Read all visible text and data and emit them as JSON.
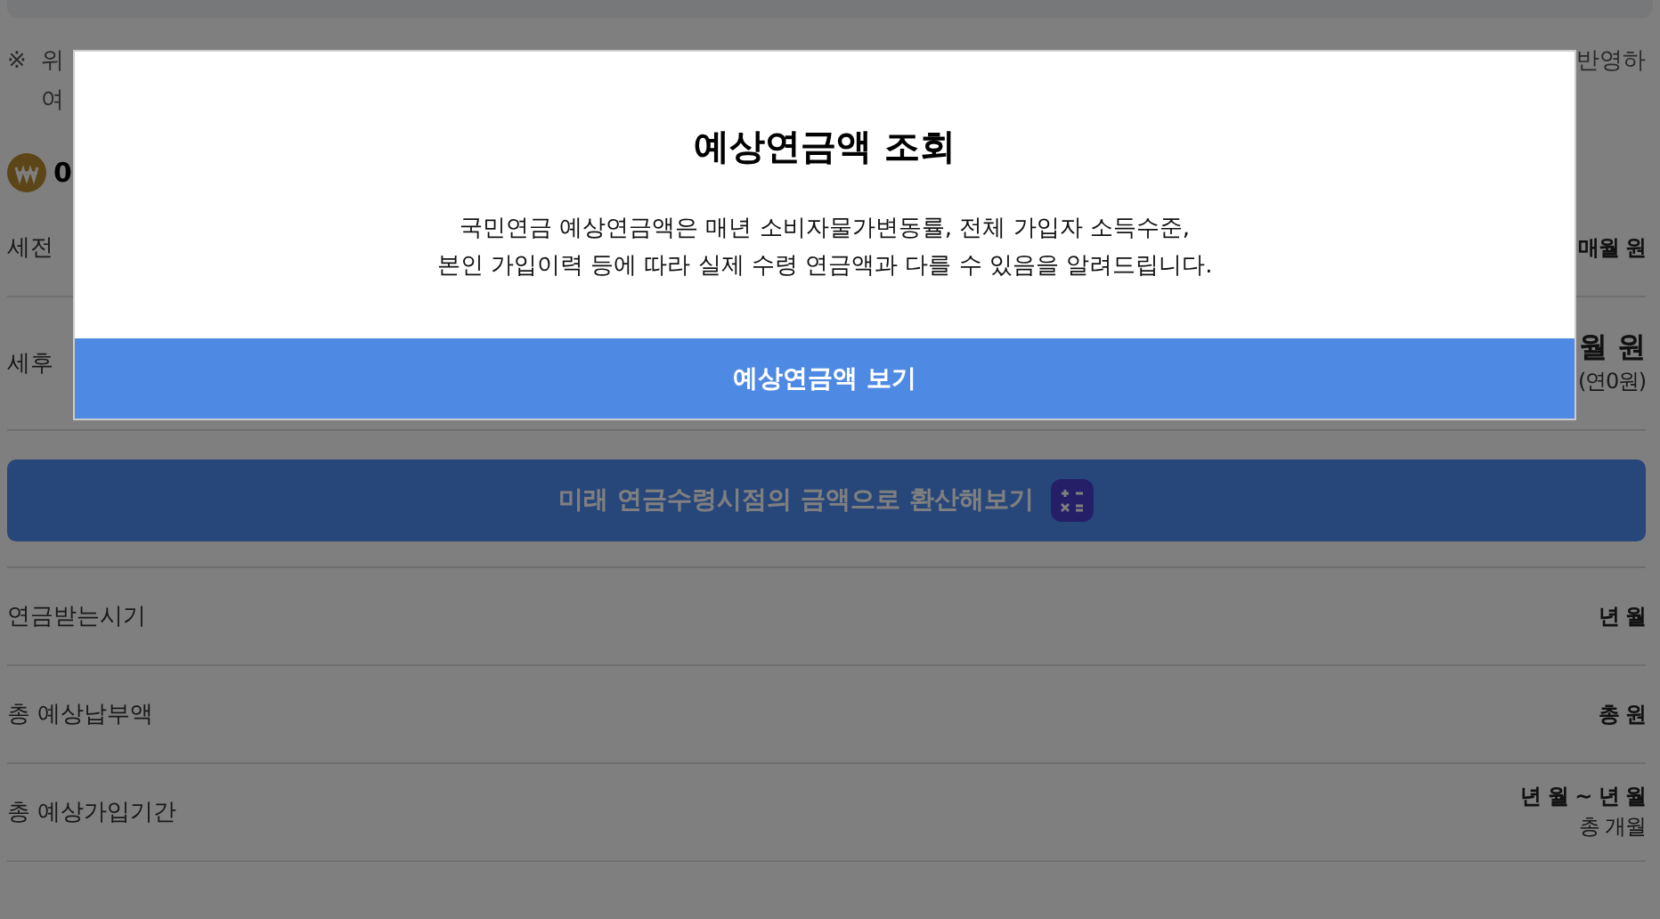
{
  "note": {
    "mark": "※",
    "lines": [
      {
        "start": "위",
        "end": "반영하"
      },
      {
        "start": "여"
      }
    ]
  },
  "amount": {
    "value": "0"
  },
  "summary_rows": [
    {
      "label": "세전",
      "value": "매월 원"
    },
    {
      "label": "세후",
      "value": "월 원",
      "sub": "(연0원)"
    }
  ],
  "convert_button": {
    "label": "미래 연금수령시점의 금액으로 환산해보기"
  },
  "detail_rows": [
    {
      "label": "연금받는시기",
      "value": "년 월"
    },
    {
      "label": "총 예상납부액",
      "value": "총 원"
    },
    {
      "label": "총 예상가입기간",
      "value": "년 월 ~ 년 월",
      "sub": "총 개월"
    }
  ],
  "dialog": {
    "title": "예상연금액 조회",
    "message": [
      "국민연금 예상연금액은 매년 소비자물가변동률, 전체 가입자 소득수준,",
      "본인 가입이력 등에 따라 실제 수령 연금액과 다를 수 있음을 알려드립니다."
    ],
    "button": "예상연금액 보기"
  }
}
